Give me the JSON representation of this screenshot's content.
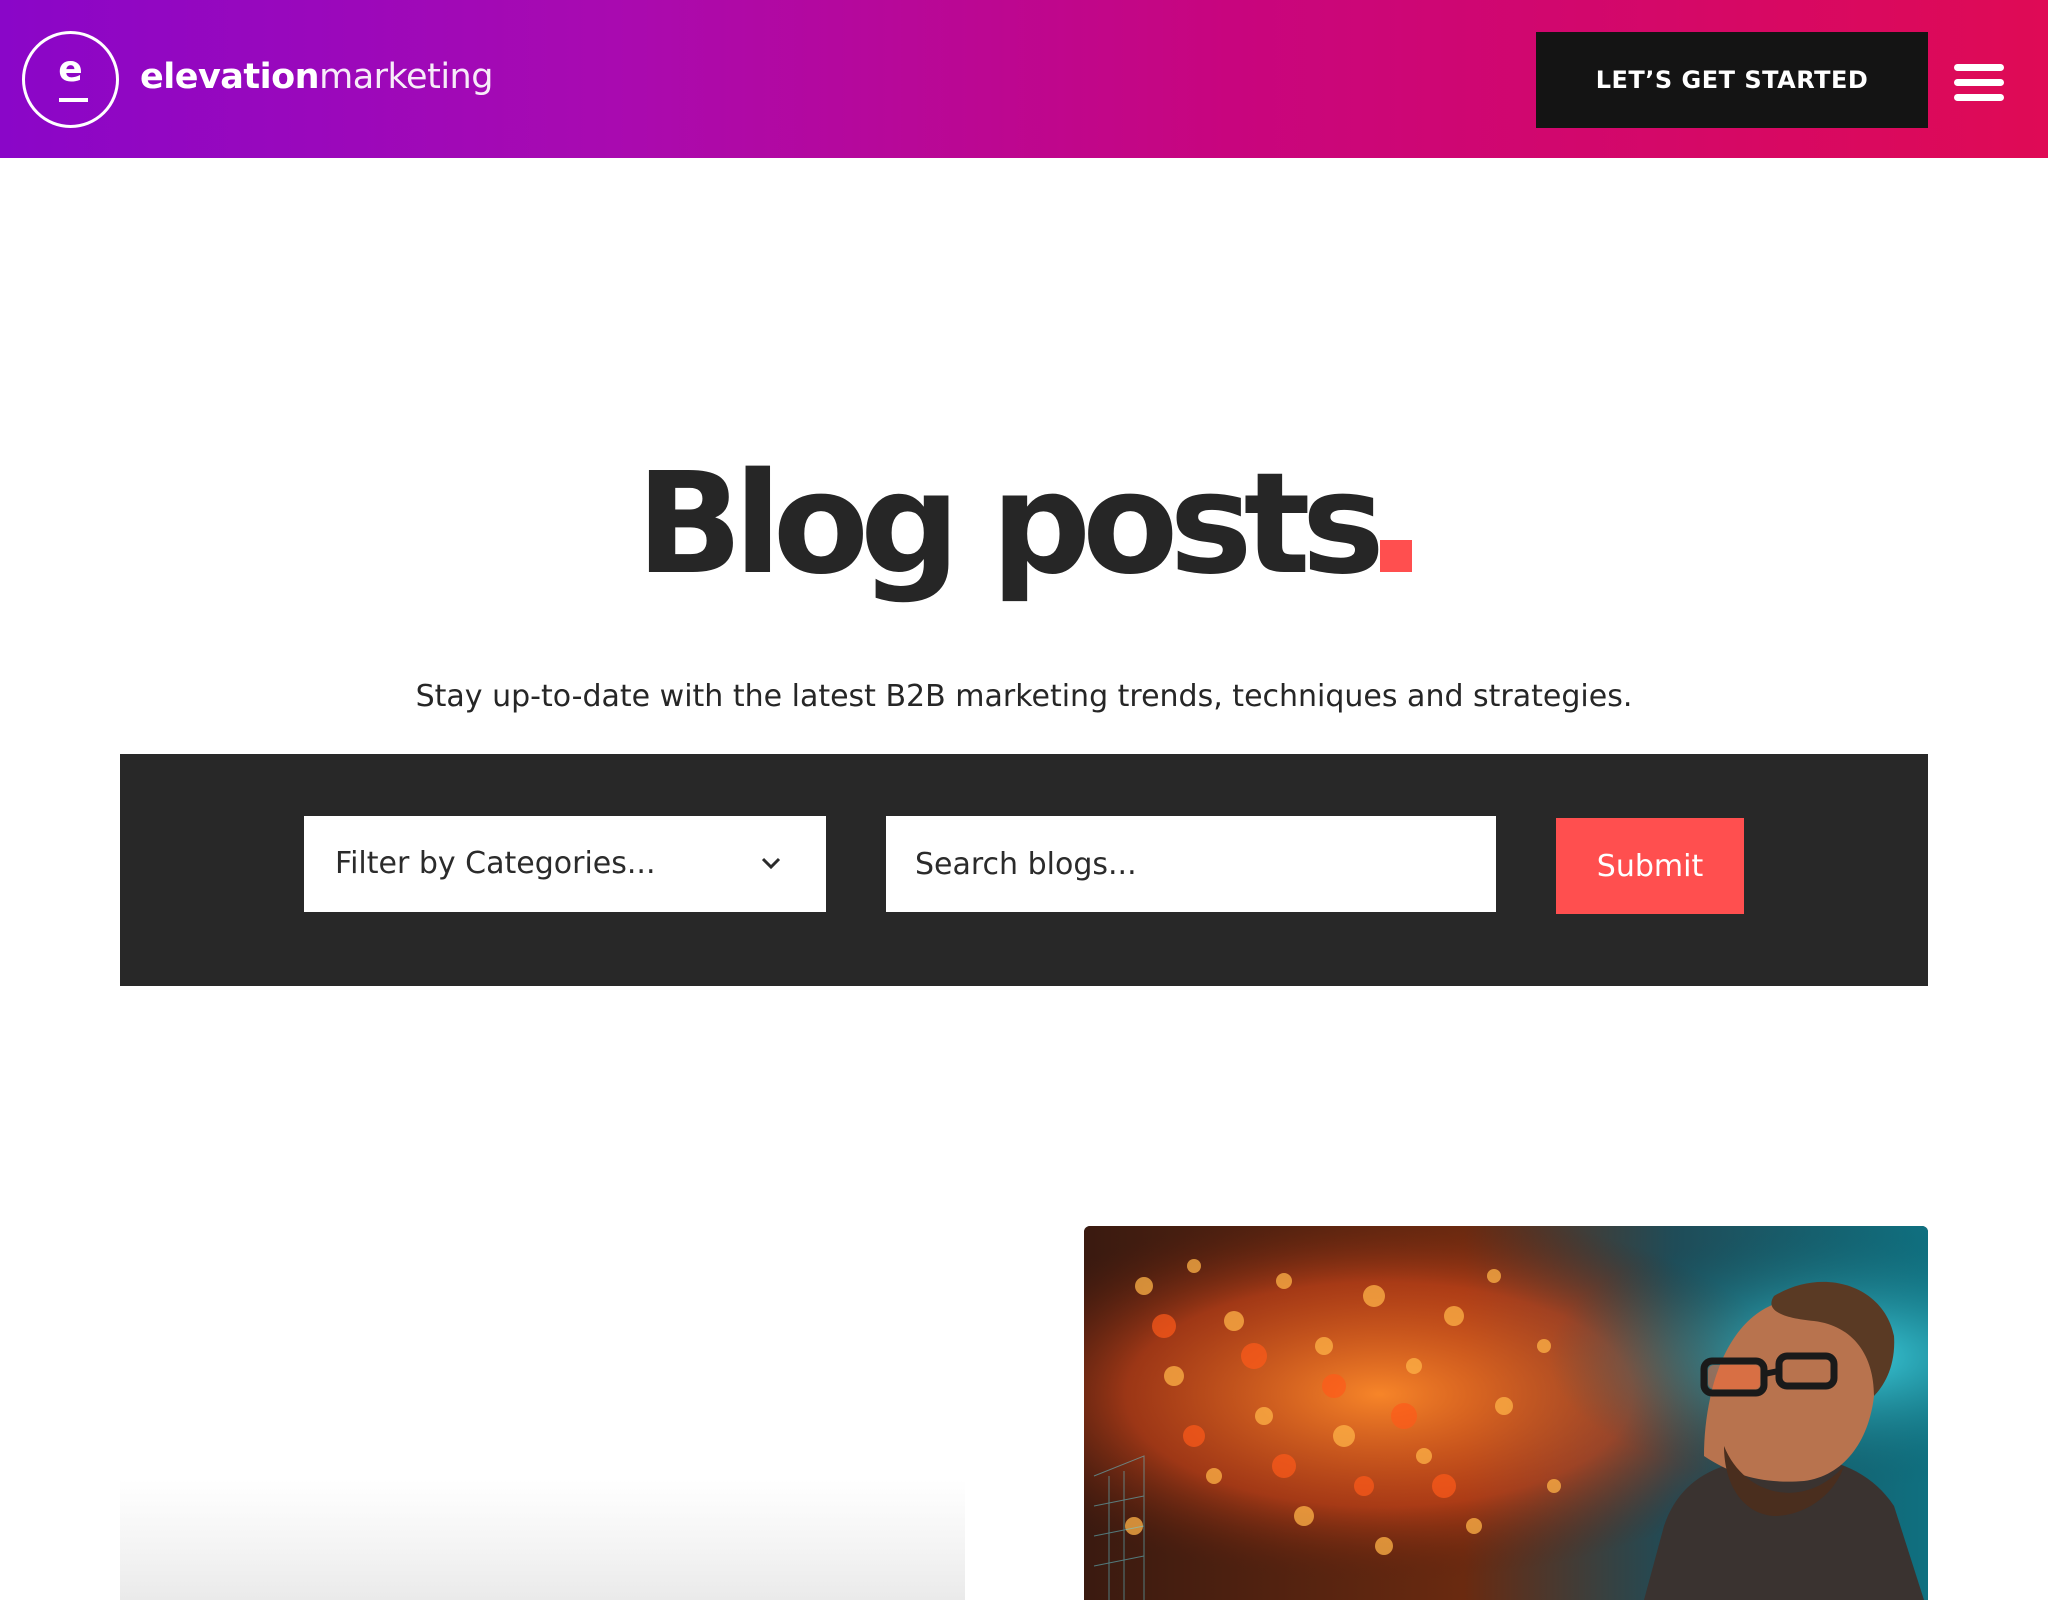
{
  "header": {
    "logo_letter": "e",
    "brand_bold": "elevation",
    "brand_light": "marketing",
    "cta_label": "LET’S GET STARTED",
    "menu_icon": "hamburger-icon"
  },
  "hero": {
    "title": "Blog posts",
    "accent_color": "#ff4f4f",
    "subtitle": "Stay up-to-date with the latest B2B marketing trends, techniques and strategies."
  },
  "filters": {
    "category_select": {
      "selected": "Filter by Categories...",
      "icon": "chevron-down-icon"
    },
    "search": {
      "placeholder": "Search blogs..."
    },
    "submit_label": "Submit"
  },
  "colors": {
    "header_gradient": [
      "#8a06c8",
      "#c8057e",
      "#df0a55"
    ],
    "dark": "#282828",
    "accent": "#ff4f4f"
  }
}
